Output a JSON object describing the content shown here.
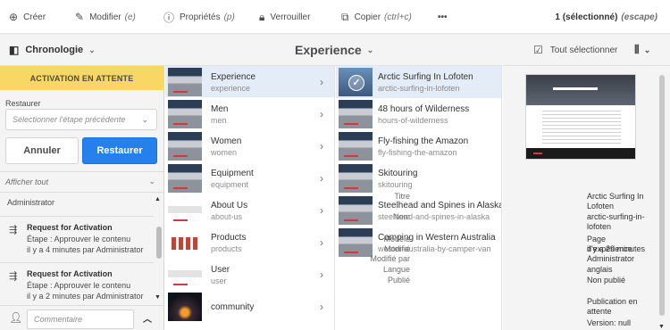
{
  "toolbar": {
    "create": "Créer",
    "edit": "Modifier",
    "edit_hint": "(e)",
    "properties": "Propriétés",
    "properties_hint": "(p)",
    "lock": "Verrouiller",
    "copy": "Copier",
    "copy_hint": "(ctrl+c)",
    "more": "•••",
    "selection": "1 (sélectionné)",
    "selection_hint": "(escape)"
  },
  "secondbar": {
    "rail_label": "Chronologie",
    "breadcrumb": "Experience",
    "select_all": "Tout sélectionner"
  },
  "rail": {
    "banner": "ACTIVATION EN ATTENTE",
    "restore_label": "Restaurer",
    "select_placeholder": "Sélectionner l'étape précédente",
    "cancel": "Annuler",
    "restore": "Restaurer",
    "show_all": "Afficher tout",
    "admin_top": "Administrator",
    "events": [
      {
        "title": "Request for Activation",
        "step": "Étape : Approuver le contenu",
        "time": "il y a 4 minutes par Administrator"
      },
      {
        "title": "Request for Activation",
        "step": "Étape : Approuver le contenu",
        "time": "il y a 2 minutes par Administrator"
      }
    ],
    "comment_placeholder": "Commentaire"
  },
  "column1": [
    {
      "title": "Experience",
      "name": "experience"
    },
    {
      "title": "Men",
      "name": "men"
    },
    {
      "title": "Women",
      "name": "women"
    },
    {
      "title": "Equipment",
      "name": "equipment"
    },
    {
      "title": "About Us",
      "name": "about-us"
    },
    {
      "title": "Products",
      "name": "products"
    },
    {
      "title": "User",
      "name": "user"
    },
    {
      "title": "community",
      "name": ""
    }
  ],
  "column2": [
    {
      "title": "Arctic Surfing In Lofoten",
      "name": "arctic-surfing-in-lofoten"
    },
    {
      "title": "48 hours of Wilderness",
      "name": "hours-of-wilderness"
    },
    {
      "title": "Fly-fishing the Amazon",
      "name": "fly-fishing-the-amazon"
    },
    {
      "title": "Skitouring",
      "name": "skitouring"
    },
    {
      "title": "Steelhead and Spines in Alaska",
      "name": "steelhead-and-spines-in-alaska"
    },
    {
      "title": "Camping in Western Australia",
      "name": "wester-australia-by-camper-van"
    }
  ],
  "details": {
    "title_k": "Titre",
    "title_v": "Arctic Surfing In Lofoten",
    "name_k": "Nom",
    "name_v": "arctic-surfing-in-lofoten",
    "model_k": "Modèle",
    "model_v": "Page d'expérience",
    "modified_k": "Modifié",
    "modified_v": "il y a 29 minutes",
    "modified_by_k": "Modifié par",
    "modified_by_v": "Administrator",
    "lang_k": "Langue",
    "lang_v": "anglais",
    "published_k": "Publié",
    "published_v": "Non publié",
    "status_v": "Publication en attente",
    "version_v": "Version: null"
  },
  "colors": {
    "accent": "#2680eb",
    "banner": "#f8d764"
  }
}
